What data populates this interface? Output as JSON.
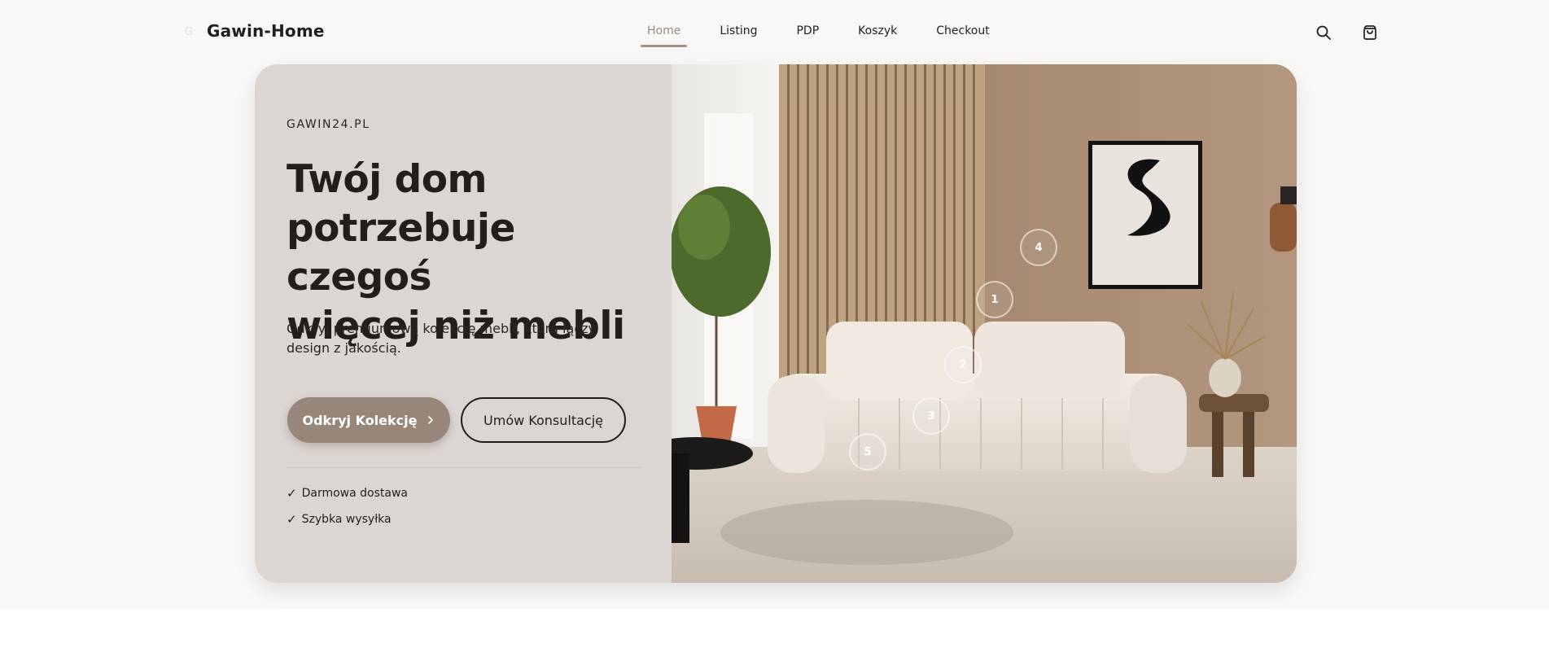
{
  "brand": {
    "name": "Gawin-Home",
    "logo_icon": "logo-mark-icon"
  },
  "nav": {
    "items": [
      {
        "label": "Home",
        "active": true
      },
      {
        "label": "Listing",
        "active": false
      },
      {
        "label": "PDP",
        "active": false
      },
      {
        "label": "Koszyk",
        "active": false
      },
      {
        "label": "Checkout",
        "active": false
      }
    ]
  },
  "header_icons": [
    "search-icon",
    "shopping-bag-icon"
  ],
  "hero": {
    "eyebrow": "GAWIN24.PL",
    "headline_line1": "Twój dom",
    "headline_line2": "potrzebuje czegoś",
    "headline_line3": "więcej niż mebli",
    "subtext": "Odkryj premiumową kolekcję mebli, która łączy design z jakością.",
    "primary_cta": "Odkryj Kolekcję",
    "secondary_cta": "Umów Konsultację",
    "features": [
      "Darmowa dostawa",
      "Szybka wysyłka"
    ],
    "hotspots": [
      "1",
      "2",
      "3",
      "4",
      "5"
    ]
  },
  "colors": {
    "accent": "#978679",
    "panel": "#dbd6d2",
    "text": "#221e1c",
    "nav_active": "#9b8a7e"
  }
}
